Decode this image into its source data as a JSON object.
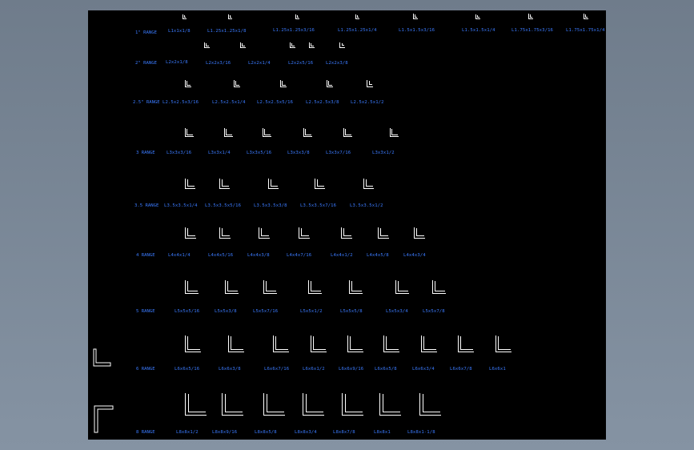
{
  "rows": [
    {
      "label": "1\" RANGE",
      "items": [
        "L1x1x1/8",
        "L1.25x1.25x1/8",
        "L1.25x1.25x3/16",
        "L1.25x1.25x1/4",
        "L1.5x1.5x3/16",
        "L1.5x1.5x1/4",
        "L1.75x1.75x3/16",
        "L1.75x1.75x1/4"
      ]
    },
    {
      "label": "2\" RANGE",
      "items": [
        "L2x2x1/8",
        "L2x2x3/16",
        "L2x2x1/4",
        "L2x2x5/16",
        "L2x2x3/8"
      ]
    },
    {
      "label": "2.5\" RANGE",
      "items": [
        "L2.5x2.5x3/16",
        "L2.5x2.5x1/4",
        "L2.5x2.5x5/16",
        "L2.5x2.5x3/8",
        "L2.5x2.5x1/2"
      ]
    },
    {
      "label": "3 RANGE",
      "items": [
        "L3x3x3/16",
        "L3x3x1/4",
        "L3x3x5/16",
        "L3x3x3/8",
        "L3x3x7/16",
        "L3x3x1/2"
      ]
    },
    {
      "label": "3.5 RANGE",
      "items": [
        "L3.5x3.5x1/4",
        "L3.5x3.5x5/16",
        "L3.5x3.5x3/8",
        "L3.5x3.5x7/16",
        "L3.5x3.5x1/2"
      ]
    },
    {
      "label": "4 RANGE",
      "items": [
        "L4x4x1/4",
        "L4x4x5/16",
        "L4x4x3/8",
        "L4x4x7/16",
        "L4x4x1/2",
        "L4x4x5/8",
        "L4x4x3/4"
      ]
    },
    {
      "label": "5 RANGE",
      "items": [
        "L5x5x5/16",
        "L5x5x3/8",
        "L5x5x7/16",
        "L5x5x1/2",
        "L5x5x5/8",
        "L5x5x3/4",
        "L5x5x7/8"
      ]
    },
    {
      "label": "6 RANGE",
      "items": [
        "L6x6x5/16",
        "L6x6x3/8",
        "L6x6x7/16",
        "L6x6x1/2",
        "L6x6x9/16",
        "L6x6x5/8",
        "L6x6x3/4",
        "L6x6x7/8",
        "L6x6x1"
      ]
    },
    {
      "label": "8 RANGE",
      "items": [
        "L8x8x1/2",
        "L8x8x9/16",
        "L8x8x5/8",
        "L8x8x3/4",
        "L8x8x7/8",
        "L8x8x1",
        "L8x8x1-1/8"
      ]
    }
  ]
}
